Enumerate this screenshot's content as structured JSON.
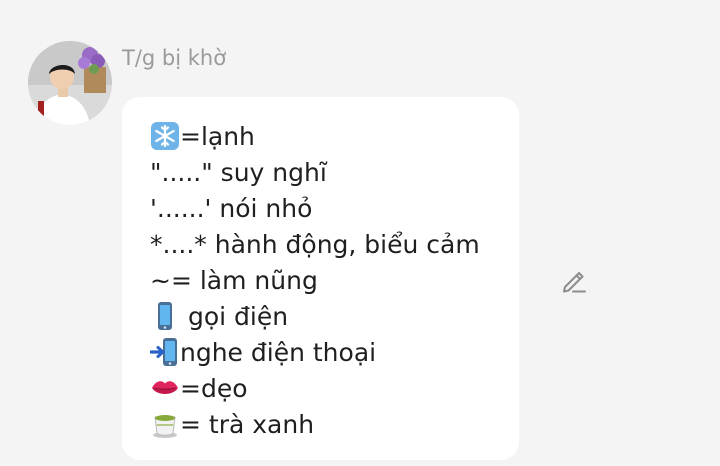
{
  "post": {
    "author": "T/g bị khờ",
    "lines": [
      {
        "icon": "snowflake-emoji",
        "text": "=lạnh"
      },
      {
        "icon": null,
        "text": "\".....\" suy nghĩ"
      },
      {
        "icon": null,
        "text": "'......' nói nhỏ"
      },
      {
        "icon": null,
        "text": "*....* hành động, biểu cảm"
      },
      {
        "icon": null,
        "text": "~= làm nũng"
      },
      {
        "icon": "mobile-phone-emoji",
        "text": " gọi điện"
      },
      {
        "icon": "mobile-phone-arrow-emoji",
        "text": "nghe điện thoại"
      },
      {
        "icon": "kiss-mark-emoji",
        "text": "=dẹo"
      },
      {
        "icon": "teacup-emoji",
        "text": "= trà xanh"
      }
    ]
  },
  "actions": {
    "edit_icon": "pencil-icon"
  },
  "colors": {
    "background": "#f4f4f4",
    "bubble": "#ffffff",
    "author_text": "#9a9a9a",
    "body_text": "#1f1f1f"
  }
}
